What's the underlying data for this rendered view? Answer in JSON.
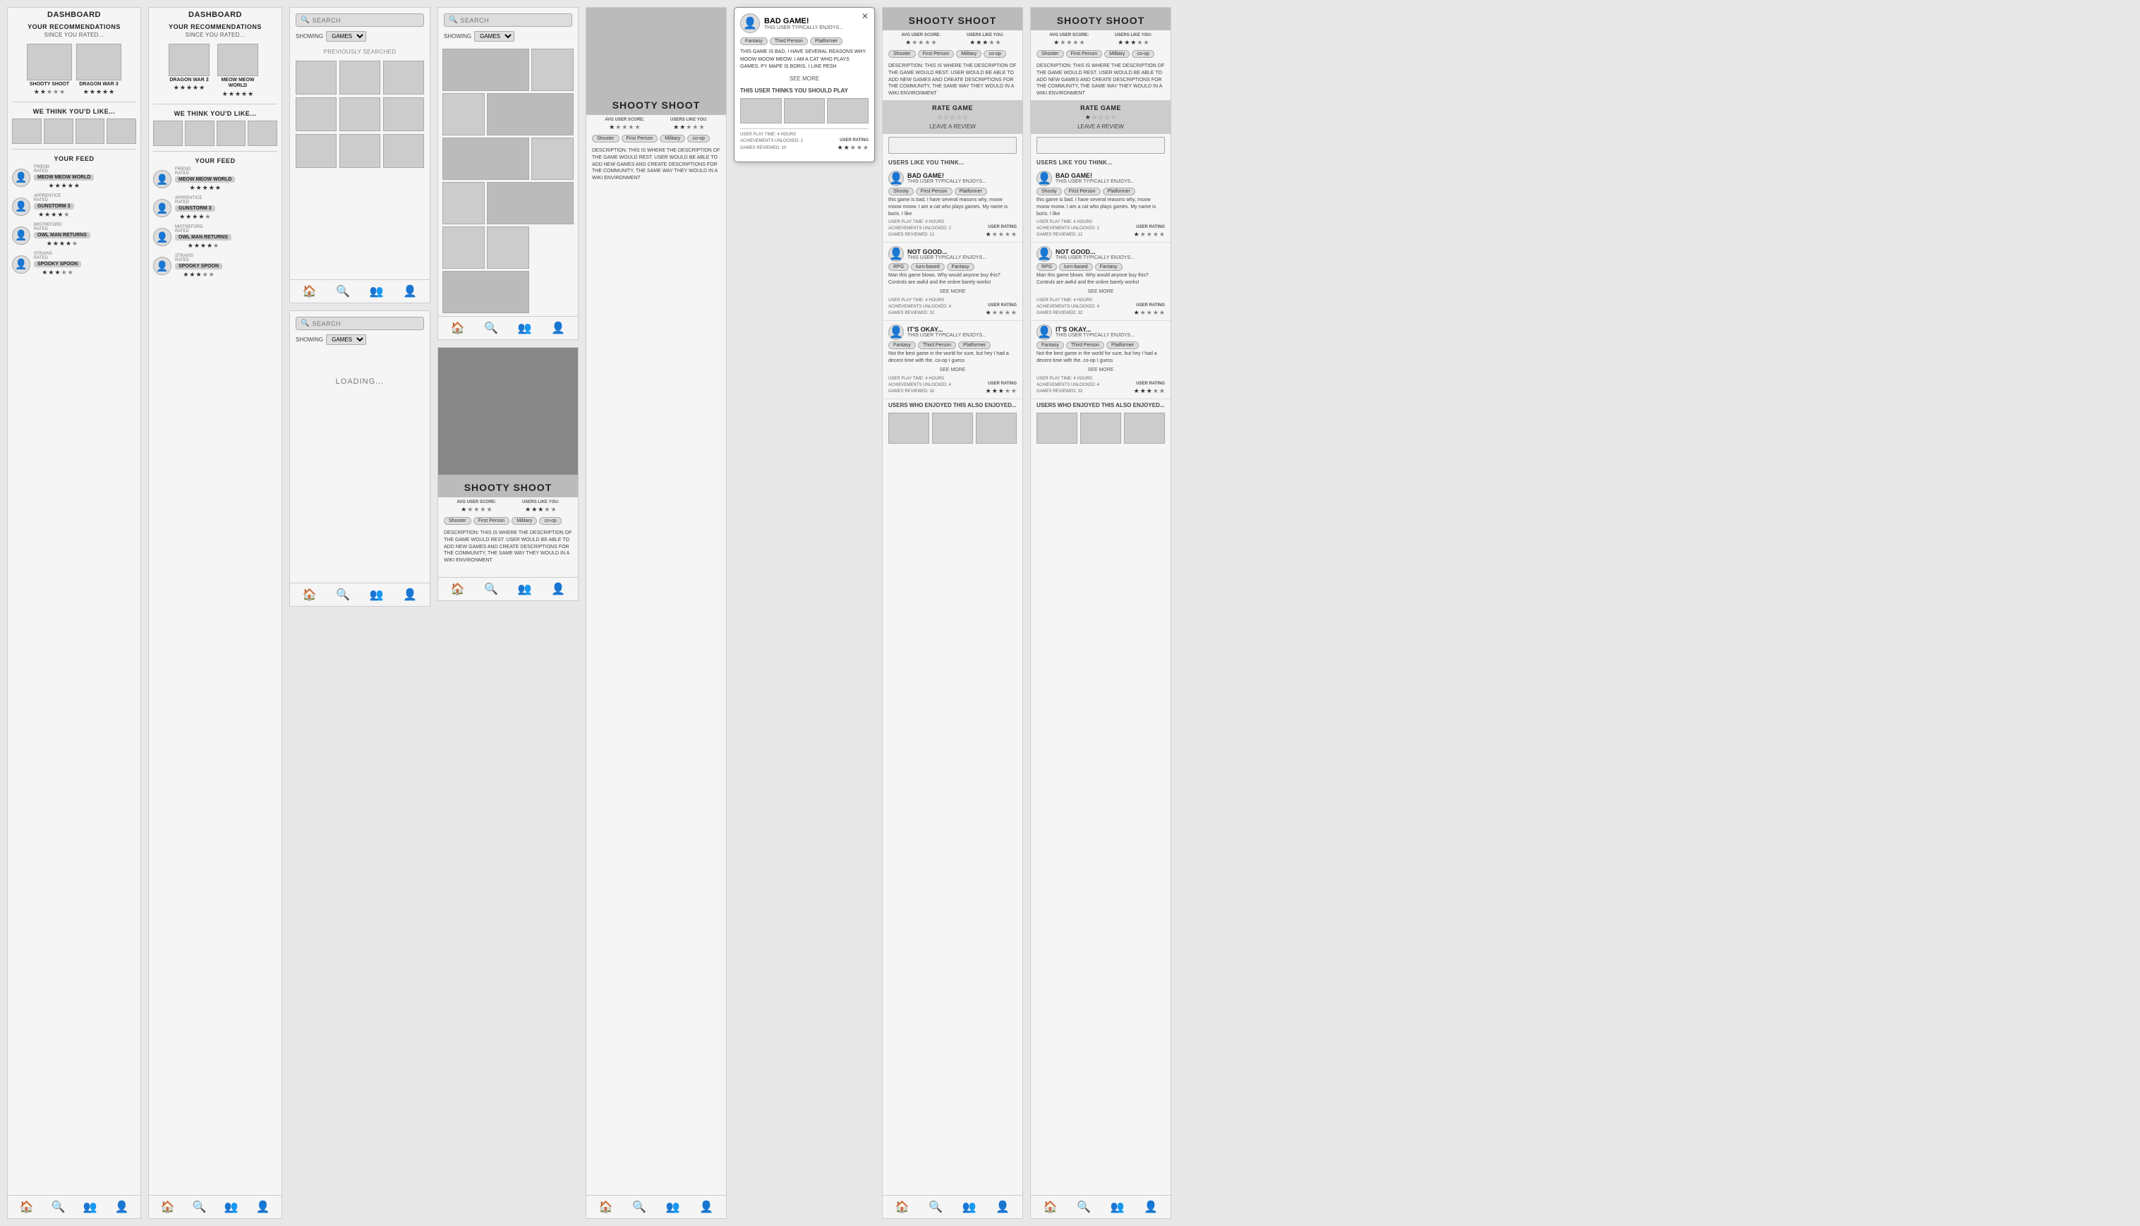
{
  "screens": {
    "dashboard1": {
      "title": "DASHBOARD",
      "rec_title": "YOUR RECOMMENDATIONS",
      "since": "SINCE YOU RATED...",
      "games": [
        {
          "name": "SHOOTY SHOOT",
          "stars": 2
        },
        {
          "name": "DRAGON WAR 3",
          "stars": 5
        }
      ],
      "think_title": "WE THINK YOU'D LIKE...",
      "feed_title": "YOUR FEED",
      "feed_items": [
        {
          "action": "RATED",
          "game": "MEOW MEOW WORLD",
          "stars": 5,
          "user_type": "FRIEND"
        },
        {
          "action": "RATED",
          "game": "GUNSTORM 3",
          "stars": 4,
          "user_type": "APPRENTICE"
        },
        {
          "action": "RATED",
          "game": "OWL MAN RETURNS",
          "stars": 4,
          "user_type": "MISTREFORD"
        },
        {
          "action": "RATED",
          "game": "SPOOKY SPOON",
          "stars": 3,
          "user_type": "STRAINS"
        }
      ],
      "nav": [
        "🏠",
        "🔍",
        "👥",
        "👤"
      ]
    },
    "dashboard2": {
      "title": "DASHBOARD",
      "rec_title": "YOUR RECOMMENDATIONS",
      "since": "SINCE YOU RATED...",
      "games": [
        {
          "name": "DRAGON WAR 3",
          "stars": 5
        },
        {
          "name": "MEOW MEOW WORLD",
          "stars": 5
        }
      ],
      "think_title": "WE THINK YOU'D LIKE...",
      "feed_title": "YOUR FEED",
      "feed_items": [
        {
          "action": "RATED",
          "game": "MEOW MEOW WORLD",
          "stars": 5,
          "user_type": "FRIEND"
        },
        {
          "action": "RATED",
          "game": "GUNSTORM 3",
          "stars": 4,
          "user_type": "APPRENTICE"
        },
        {
          "action": "RATED",
          "game": "OWL MAN RETURNS",
          "stars": 4,
          "user_type": "MISTREFORD"
        },
        {
          "action": "RATED",
          "game": "SPOOKY SPOON",
          "stars": 3,
          "user_type": "STRAINS"
        }
      ],
      "nav": [
        "🏠",
        "🔍",
        "👥",
        "👤"
      ]
    },
    "search1": {
      "placeholder": "SEARCH",
      "showing_label": "SHOWING",
      "filter": "GAMES",
      "prev_searched": "PREVIOUSLY SEARCHED",
      "nav": [
        "🏠",
        "🔍",
        "👥",
        "👤"
      ]
    },
    "search2": {
      "placeholder": "SEARCH",
      "showing_label": "SHOWING",
      "filter": "GAMES",
      "nav": [
        "🏠",
        "🔍",
        "👥",
        "👤"
      ]
    },
    "search_loading": {
      "placeholder": "SEARCH",
      "showing_label": "SHOWING",
      "filter": "GAMES",
      "loading": "LOADING...",
      "nav": [
        "🏠",
        "🔍",
        "👥",
        "👤"
      ]
    },
    "game_detail_basic": {
      "game_title": "SHOOTY SHOOT",
      "avg_score_label": "AVG USER SCORE:",
      "users_like_label": "USERS LIKE YOU:",
      "avg_stars": 1,
      "user_stars": 3,
      "tags": [
        "Shooter",
        "First Person",
        "Military",
        "co-op"
      ],
      "description": "DESCRIPTION: THIS IS WHERE THE DESCRIPTION OF THE GAME WOULD REST. USER WOULD BE ABLE TO ADD NEW GAMES AND CREATE DESCRIPTIONS FOR THE COMMUNITY, THE SAME WAY THEY WOULD IN A WIKI ENVIRONMENT",
      "nav": [
        "🏠",
        "🔍",
        "👥",
        "👤"
      ]
    },
    "game_detail_with_reviews": {
      "game_title": "SHOOTY SHOOT",
      "avg_score_label": "AVG USER SCORE:",
      "users_like_label": "USERS LIKE YOU:",
      "avg_stars": 1,
      "user_stars": 3,
      "tags": [
        "Shooter",
        "First Person",
        "Military",
        "co-op"
      ],
      "description": "DESCRIPTION: THIS IS WHERE THE DESCRIPTION OF THE GAME WOULD REST. USER WOULD BE ABLE TO ADD NEW GAMES AND CREATE DESCRIPTIONS FOR THE COMMUNITY, THE SAME WAY THEY WOULD IN A WIKI ENVIRONMENT",
      "rate_title": "RATE GAME",
      "leave_review": "LEAVE A REVIEW",
      "users_think": "USERS LIKE YOU THINK...",
      "reviews": [
        {
          "title": "BAD GAME!",
          "subtitle": "THIS USER TYPICALLY ENJOYS...",
          "tags": [
            "Shooty",
            "First Person",
            "Platformer"
          ],
          "text": "this game is bad, I have several reasons why, moow moow moow. I am a cat who plays games. My name is boris. I like",
          "play_time": "USER PLAY TIME: 4 HOURS",
          "achievements": "ACHIEVEMENTS UNLOCKED: 2",
          "games_reviewed": "GAMES REVIEWED: 12",
          "user_rating_label": "USER RATING",
          "stars": 1
        },
        {
          "title": "NOT GOOD...",
          "subtitle": "THIS USER TYPICALLY ENJOYS...",
          "tags": [
            "RPG",
            "turn-based",
            "Fantasy"
          ],
          "text": "Man this game blows. Why would anyone buy this? Controls are awful and the online barely works!",
          "see_more": "SEE MORE",
          "play_time": "USER PLAY TIME: 4 HOURS",
          "achievements": "ACHIEVEMENTS UNLOCKED: 4",
          "games_reviewed": "GAMES REVIEWED: 32",
          "user_rating_label": "USER RATING",
          "stars": 1
        },
        {
          "title": "IT'S OKAY...",
          "subtitle": "THIS USER TYPICALLY ENJOYS...",
          "tags": [
            "Fantasy",
            "Third Person",
            "Platformer"
          ],
          "text": "Not the best game in the world for sure, but hey I had a decent time with the. co-op I guess",
          "see_more": "SEE MORE",
          "play_time": "USER PLAY TIME: 4 HOURS",
          "achievements": "ACHIEVEMENTS UNLOCKED: 4",
          "games_reviewed": "GAMES REVIEWED: 32",
          "user_rating_label": "USER RATING",
          "stars": 3
        }
      ],
      "also_enjoyed": "USERS WHO ENJOYED THIS ALSO ENJOYED...",
      "nav": [
        "🏠",
        "🔍",
        "👥",
        "👤"
      ]
    },
    "popup": {
      "title": "BAD GAME!",
      "subtitle": "THIS USER TYPICALLY ENJOYS...",
      "tags": [
        "Fantasy",
        "Third Person",
        "Platformer"
      ],
      "text": "THIS GAME IS BAD, I HAVE SEVERAL REASONS WHY. MOOW MOOW MEOW. I AM A CAT WHO PLAYS GAMES. PY MAPE IS BORIS. I LIKE PESH",
      "thinks_play": "THIS USER THINKS YOU SHOULD PLAY",
      "see_more": "SEE MORE",
      "play_time": "USER PLAY TIME: 4 HOURS",
      "achievements": "ACHIEVEMENTS UNLOCKED: 2",
      "games_reviewed": "GAMES REVIEWED: 10",
      "user_rating_label": "USER RATING",
      "stars": 2
    },
    "detail_with_rate": {
      "game_title": "SHOOTY SHOOT",
      "avg_score_label": "AVG USER SCORE:",
      "users_like_label": "USERS LIKE YOU:",
      "avg_stars": 1,
      "user_stars": 3,
      "tags": [
        "Shooter",
        "First Person",
        "Military",
        "co-op"
      ],
      "description": "DESCRIPTION: THIS IS WHERE THE DESCRIPTION OF THE GAME WOULD REST. USER WOULD BE ABLE TO ADD NEW GAMES AND CREATE DESCRIPTIONS FOR THE COMMUNITY, THE SAME WAY THEY WOULD IN A WIKI ENVIRONMENT",
      "rate_title": "RATE GAME",
      "leave_review": "LEAVE A REVIEW",
      "rate_stars": 1,
      "users_think": "USERS LIKE YOU THINK...",
      "nav": [
        "🏠",
        "🔍",
        "👥",
        "👤"
      ]
    }
  }
}
